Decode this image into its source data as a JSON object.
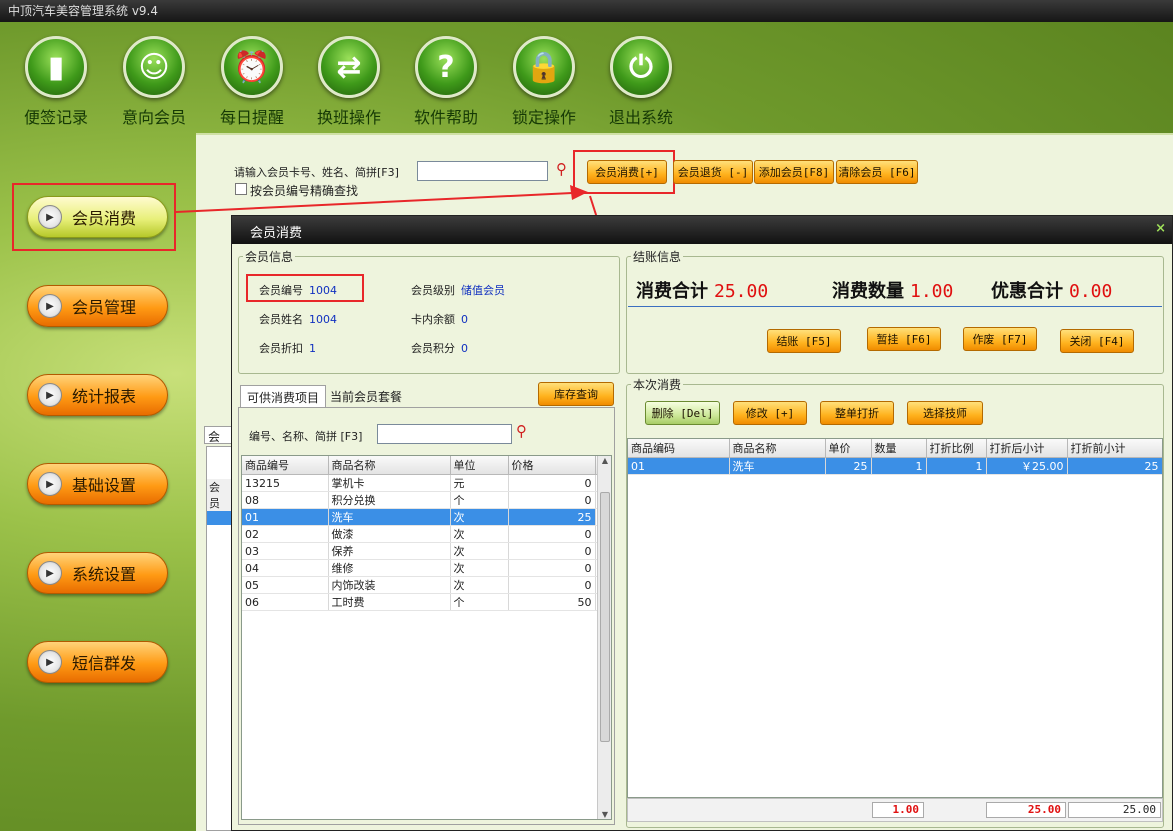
{
  "window": {
    "title": "中顶汽车美容管理系统 v9.4"
  },
  "toolbar": [
    {
      "label": "便签记录",
      "icon": "note-icon",
      "glyph": "▮"
    },
    {
      "label": "意向会员",
      "icon": "person-icon",
      "glyph": "☺"
    },
    {
      "label": "每日提醒",
      "icon": "alarm-clock-icon",
      "glyph": "⏰"
    },
    {
      "label": "换班操作",
      "icon": "swap-arrows-icon",
      "glyph": "⇄"
    },
    {
      "label": "软件帮助",
      "icon": "help-icon",
      "glyph": "?"
    },
    {
      "label": "锁定操作",
      "icon": "lock-icon",
      "glyph": "🔒"
    },
    {
      "label": "退出系统",
      "icon": "power-icon",
      "glyph": "⏻"
    }
  ],
  "nav": [
    {
      "label": "会员消费",
      "active": true
    },
    {
      "label": "会员管理"
    },
    {
      "label": "统计报表"
    },
    {
      "label": "基础设置"
    },
    {
      "label": "系统设置"
    },
    {
      "label": "短信群发"
    }
  ],
  "search": {
    "prompt": "请输入会员卡号、姓名、简拼[F3]",
    "value": "",
    "exact_label": "按会员编号精确查找"
  },
  "actions": {
    "consume": "会员消费[+]",
    "refund": "会员退货 [-]",
    "add_member": "添加会员[F8]",
    "clear_member": "清除会员 [F6]"
  },
  "bg_fragments": {
    "tab": "会员",
    "col": "会员"
  },
  "modal": {
    "title": "会员消费",
    "close": "×",
    "member_info": {
      "legend": "会员信息",
      "id_label": "会员编号",
      "id_value": "1004",
      "level_label": "会员级别",
      "level_value": "储值会员",
      "name_label": "会员姓名",
      "name_value": "1004",
      "balance_label": "卡内余额",
      "balance_value": "0",
      "discount_label": "会员折扣",
      "discount_value": "1",
      "points_label": "会员积分",
      "points_value": "0"
    },
    "checkout": {
      "legend": "结账信息",
      "total_label": "消费合计",
      "total_value": "25.00",
      "qty_label": "消费数量",
      "qty_value": "1.00",
      "discount_label": "优惠合计",
      "discount_value": "0.00",
      "btn_checkout": "结账 [F5]",
      "btn_hold": "暂挂 [F6]",
      "btn_void": "作废 [F7]",
      "btn_close": "关闭 [F4]"
    },
    "left_tabs": {
      "available": "可供消费项目",
      "packages": "当前会员套餐",
      "stock_query": "库存查询"
    },
    "item_search": {
      "prompt": "编号、名称、简拼 [F3]",
      "value": ""
    },
    "items": {
      "headers": [
        "商品编号",
        "商品名称",
        "单位",
        "价格"
      ],
      "rows": [
        [
          "13215",
          "掌机卡",
          "元",
          "0"
        ],
        [
          "08",
          "积分兑换",
          "个",
          "0"
        ],
        [
          "01",
          "洗车",
          "次",
          "25"
        ],
        [
          "02",
          "做漆",
          "次",
          "0"
        ],
        [
          "03",
          "保养",
          "次",
          "0"
        ],
        [
          "04",
          "维修",
          "次",
          "0"
        ],
        [
          "05",
          "内饰改装",
          "次",
          "0"
        ],
        [
          "06",
          "工时费",
          "个",
          "50"
        ]
      ],
      "selected_index": 2
    },
    "current": {
      "legend": "本次消费",
      "btn_delete": "删除 [Del]",
      "btn_edit": "修改 [+]",
      "btn_bulk_discount": "整单打折",
      "btn_technician": "选择技师",
      "headers": [
        "商品编码",
        "商品名称",
        "单价",
        "数量",
        "打折比例",
        "打折后小计",
        "打折前小计"
      ],
      "rows": [
        [
          "01",
          "洗车",
          "25",
          "1",
          "1",
          "￥25.00",
          "25"
        ]
      ],
      "footer": {
        "qty": "1.00",
        "after": "25.00",
        "before": "25.00"
      }
    }
  }
}
